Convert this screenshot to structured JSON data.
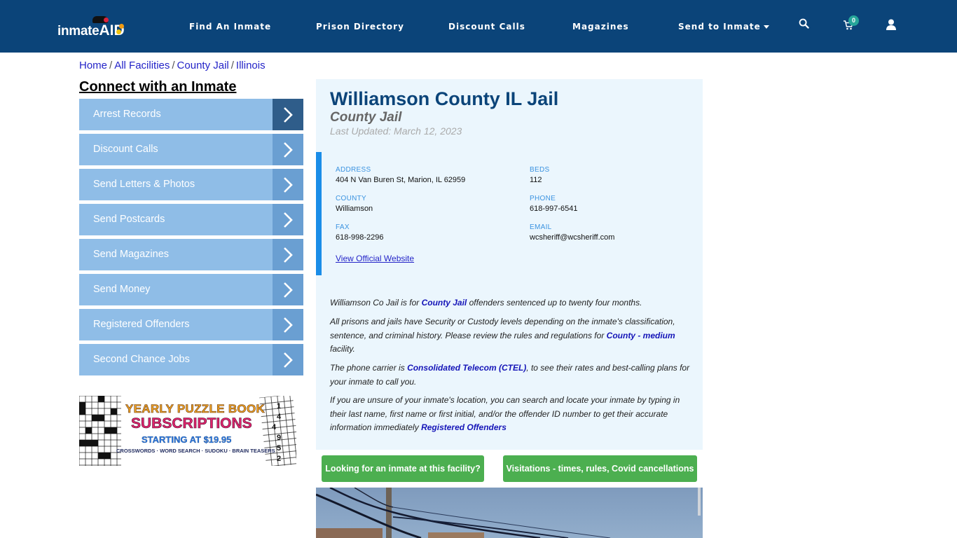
{
  "header": {
    "logo_text": "inmate",
    "logo_accent": "AID",
    "nav": [
      {
        "label": "Find An Inmate"
      },
      {
        "label": "Prison Directory"
      },
      {
        "label": "Discount Calls"
      },
      {
        "label": "Magazines"
      },
      {
        "label": "Send to Inmate",
        "has_dropdown": true
      }
    ],
    "icons": {
      "search": "search-icon",
      "cart": "cart-icon",
      "user": "user-icon"
    },
    "cart_count": "0",
    "colors": {
      "bar": "#0b4479",
      "badge": "#26a69a"
    }
  },
  "breadcrumb": [
    {
      "label": "Home"
    },
    {
      "label": "All Facilities"
    },
    {
      "label": "County Jail"
    },
    {
      "label": "Illinois"
    }
  ],
  "sidebar": {
    "title": "Connect with an Inmate",
    "items": [
      {
        "label": "Arrest Records"
      },
      {
        "label": "Discount Calls"
      },
      {
        "label": "Send Letters & Photos"
      },
      {
        "label": "Send Postcards"
      },
      {
        "label": "Send Magazines"
      },
      {
        "label": "Send Money"
      },
      {
        "label": "Registered Offenders"
      },
      {
        "label": "Second Chance Jobs"
      }
    ],
    "ad": {
      "line1": "YEARLY PUZZLE BOOK",
      "line2": "SUBSCRIPTIONS",
      "line3": "STARTING AT $19.95",
      "line4": "CROSSWORDS · WORD SEARCH · SUDOKU · BRAIN TEASERS",
      "sudoku_digits": [
        "1",
        "4",
        "4",
        "9",
        "5",
        "2"
      ]
    }
  },
  "facility": {
    "title": "Williamson County IL Jail",
    "type": "County Jail",
    "last_updated": "Last Updated: March 12, 2023",
    "fields": {
      "address": {
        "label": "ADDRESS",
        "value": "404 N Van Buren St, Marion, IL 62959"
      },
      "beds": {
        "label": "BEDS",
        "value": "112"
      },
      "county": {
        "label": "COUNTY",
        "value": "Williamson"
      },
      "phone": {
        "label": "PHONE",
        "value": "618-997-6541"
      },
      "fax": {
        "label": "FAX",
        "value": "618-998-2296"
      },
      "email": {
        "label": "EMAIL",
        "value": "wcsheriff@wcsheriff.com"
      }
    },
    "website_label": "View Official Website",
    "description": {
      "p1_a": "Williamson Co Jail is for ",
      "p1_link": "County Jail",
      "p1_b": " offenders sentenced up to twenty four months.",
      "p2_a": "All prisons and jails have Security or Custody levels depending on the inmate's classification, sentence, and criminal history. Please review the rules and regulations for ",
      "p2_link": "County - medium",
      "p2_b": " facility.",
      "p3_a": "The phone carrier is ",
      "p3_link": "Consolidated Telecom (CTEL)",
      "p3_b": ", to see their rates and best-calling plans for your inmate to call you.",
      "p4_a": "If you are unsure of your inmate's location, you can search and locate your inmate by typing in their last name, first name or first initial, and/or the offender ID number to get their accurate information immediately ",
      "p4_link": "Registered Offenders"
    },
    "buttons": {
      "find_inmate": "Looking for an inmate at this facility?",
      "visitations": "Visitations - times, rules, Covid cancellations"
    }
  }
}
